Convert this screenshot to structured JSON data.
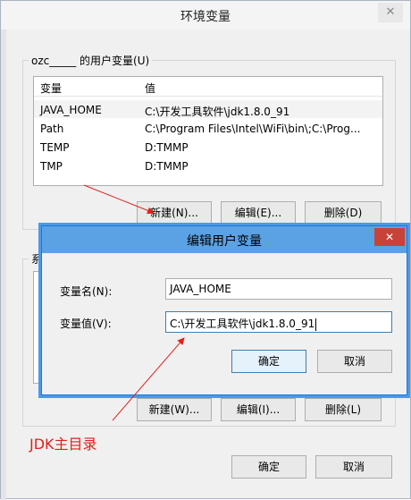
{
  "outer_window": {
    "title": "环境变量",
    "close_glyph": "✕",
    "user_group_label": "ozc_____ 的用户变量(U)",
    "system_group_label": "系",
    "columns": [
      "变量",
      "值"
    ],
    "user_vars": [
      {
        "name": "JAVA_HOME",
        "value": "C:\\开发工具软件\\jdk1.8.0_91"
      },
      {
        "name": "Path",
        "value": "C:\\Program Files\\Intel\\WiFi\\bin\\;C:\\Prog..."
      },
      {
        "name": "TEMP",
        "value": "D:TMMP"
      },
      {
        "name": "TMP",
        "value": "D:TMMP"
      }
    ],
    "user_buttons": {
      "new": "新建(N)...",
      "edit": "编辑(E)...",
      "delete": "删除(D)"
    },
    "system_buttons": {
      "new": "新建(W)...",
      "edit": "编辑(I)...",
      "delete": "删除(L)"
    },
    "ok": "确定",
    "cancel": "取消"
  },
  "edit_dialog": {
    "title": "编辑用户变量",
    "close_glyph": "✕",
    "name_label": "变量名(N):",
    "name_value": "JAVA_HOME",
    "value_label": "变量值(V):",
    "value_value": "C:\\开发工具软件\\jdk1.8.0_91",
    "ok": "确定",
    "cancel": "取消"
  },
  "annotation": {
    "text": "JDK主目录",
    "color": "#e0201b"
  },
  "colors": {
    "dialog_title": "#5ba2e5",
    "close_red": "#c7433a",
    "focus_border": "#3c7fb1"
  }
}
